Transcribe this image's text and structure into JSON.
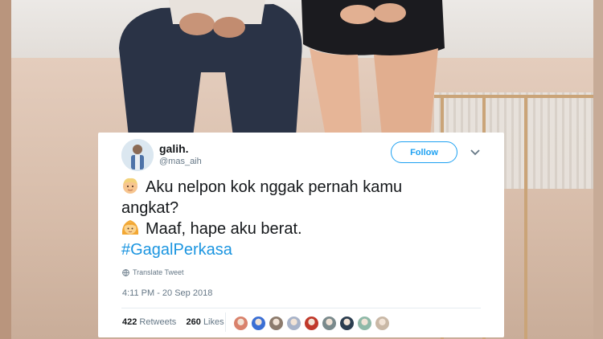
{
  "tweet": {
    "display_name": "galih.",
    "handle": "@mas_aih",
    "follow_label": "Follow",
    "lines": [
      {
        "emoji": "person-blond-emoji",
        "text": "Aku nelpon kok nggak pernah kamu"
      },
      {
        "emoji": "",
        "text": "angkat?"
      },
      {
        "emoji": "person-girl-emoji",
        "text": "Maaf, hape aku berat."
      }
    ],
    "hashtag": "#GagalPerkasa",
    "translate_label": "Translate Tweet",
    "timestamp": "4:11 PM - 20 Sep 2018",
    "retweets_count": "422",
    "retweets_label": "Retweets",
    "likes_count": "260",
    "likes_label": "Likes",
    "liker_colors": [
      "#d9826c",
      "#3b6fd4",
      "#8c7b6d",
      "#a8b3c9",
      "#c0392b",
      "#7a8a8c",
      "#2c3e50",
      "#8fb9a8",
      "#c9b8a6"
    ]
  },
  "colors": {
    "accent": "#1da1f2",
    "hashtag": "#1b95e0",
    "text": "#14171a",
    "muted": "#657786"
  }
}
